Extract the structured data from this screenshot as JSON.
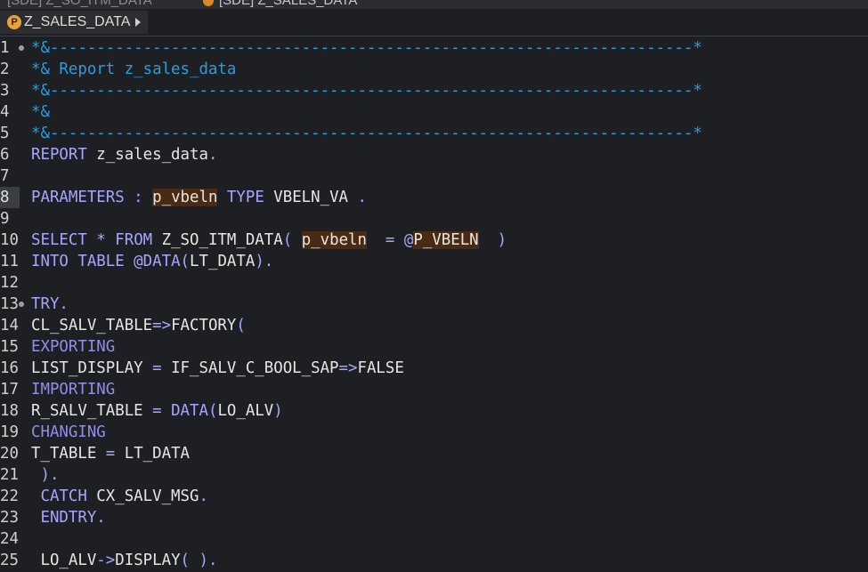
{
  "tabs": [
    {
      "label": "[SDE] Z_SO_ITM_DATA"
    },
    {
      "label": "[SDE] Z_SALES_DATA"
    }
  ],
  "breadcrumb": {
    "icon_letter": "P",
    "label": "Z_SALES_DATA"
  },
  "lines": [
    {
      "n": "1",
      "fold": true,
      "tokens": [
        {
          "t": "*&---------------------------------------------------------------------*",
          "c": "cm"
        }
      ]
    },
    {
      "n": "2",
      "tokens": [
        {
          "t": "*& Report z_sales_data",
          "c": "cm"
        }
      ]
    },
    {
      "n": "3",
      "tokens": [
        {
          "t": "*&---------------------------------------------------------------------*",
          "c": "cm"
        }
      ]
    },
    {
      "n": "4",
      "tokens": [
        {
          "t": "*&",
          "c": "cm"
        }
      ]
    },
    {
      "n": "5",
      "tokens": [
        {
          "t": "*&---------------------------------------------------------------------*",
          "c": "cm"
        }
      ]
    },
    {
      "n": "6",
      "tokens": [
        {
          "t": "REPORT",
          "c": "kw"
        },
        {
          "t": " z_sales_data",
          "c": "id"
        },
        {
          "t": ".",
          "c": "pu"
        }
      ]
    },
    {
      "n": "7",
      "tokens": []
    },
    {
      "n": "8",
      "current": true,
      "tokens": [
        {
          "t": "PARAMETERS",
          "c": "kw"
        },
        {
          "t": " : ",
          "c": "pu"
        },
        {
          "t": "p_vbeln",
          "c": "var"
        },
        {
          "t": " ",
          "c": "id"
        },
        {
          "t": "TYPE",
          "c": "kw"
        },
        {
          "t": " VBELN_VA ",
          "c": "id"
        },
        {
          "t": ".",
          "c": "pu"
        }
      ]
    },
    {
      "n": "9",
      "tokens": []
    },
    {
      "n": "10",
      "tokens": [
        {
          "t": "SELECT",
          "c": "kw"
        },
        {
          "t": " * ",
          "c": "pu"
        },
        {
          "t": "FROM",
          "c": "kw"
        },
        {
          "t": " Z_SO_ITM_DATA",
          "c": "id"
        },
        {
          "t": "( ",
          "c": "pu"
        },
        {
          "t": "p_vbeln",
          "c": "var"
        },
        {
          "t": "  = @",
          "c": "pu"
        },
        {
          "t": "P_VBELN",
          "c": "var"
        },
        {
          "t": "  )",
          "c": "pu"
        }
      ]
    },
    {
      "n": "11",
      "tokens": [
        {
          "t": "INTO TABLE",
          "c": "kw"
        },
        {
          "t": " @",
          "c": "pu"
        },
        {
          "t": "DATA",
          "c": "kw"
        },
        {
          "t": "(",
          "c": "pu"
        },
        {
          "t": "LT_DATA",
          "c": "id"
        },
        {
          "t": ").",
          "c": "pu"
        }
      ]
    },
    {
      "n": "12",
      "tokens": []
    },
    {
      "n": "13",
      "fold": true,
      "tokens": [
        {
          "t": "TRY",
          "c": "kw"
        },
        {
          "t": ".",
          "c": "pu"
        }
      ]
    },
    {
      "n": "14",
      "tokens": [
        {
          "t": "CL_SALV_TABLE",
          "c": "id"
        },
        {
          "t": "=>",
          "c": "pu"
        },
        {
          "t": "FACTORY",
          "c": "id"
        },
        {
          "t": "(",
          "c": "pu"
        }
      ]
    },
    {
      "n": "15",
      "tokens": [
        {
          "t": "EXPORTING",
          "c": "kw2"
        }
      ]
    },
    {
      "n": "16",
      "tokens": [
        {
          "t": "LIST_DISPLAY",
          "c": "id"
        },
        {
          "t": " = ",
          "c": "pu"
        },
        {
          "t": "IF_SALV_C_BOOL_SAP",
          "c": "id"
        },
        {
          "t": "=>",
          "c": "pu"
        },
        {
          "t": "FALSE",
          "c": "id"
        }
      ]
    },
    {
      "n": "17",
      "tokens": [
        {
          "t": "IMPORTING",
          "c": "kw2"
        }
      ]
    },
    {
      "n": "18",
      "tokens": [
        {
          "t": "R_SALV_TABLE",
          "c": "id"
        },
        {
          "t": " = ",
          "c": "pu"
        },
        {
          "t": "DATA",
          "c": "kw"
        },
        {
          "t": "(",
          "c": "pu"
        },
        {
          "t": "LO_ALV",
          "c": "id"
        },
        {
          "t": ")",
          "c": "pu"
        }
      ]
    },
    {
      "n": "19",
      "tokens": [
        {
          "t": "CHANGING",
          "c": "kw2"
        }
      ]
    },
    {
      "n": "20",
      "tokens": [
        {
          "t": "T_TABLE",
          "c": "id"
        },
        {
          "t": " = ",
          "c": "pu"
        },
        {
          "t": "LT_DATA",
          "c": "id"
        }
      ]
    },
    {
      "n": "21",
      "tokens": [
        {
          "t": " ).",
          "c": "pu"
        }
      ]
    },
    {
      "n": "22",
      "tokens": [
        {
          "t": " CATCH",
          "c": "kw"
        },
        {
          "t": " CX_SALV_MSG",
          "c": "id"
        },
        {
          "t": ".",
          "c": "pu"
        }
      ]
    },
    {
      "n": "23",
      "tokens": [
        {
          "t": " ENDTRY",
          "c": "kw"
        },
        {
          "t": ".",
          "c": "pu"
        }
      ]
    },
    {
      "n": "24",
      "tokens": []
    },
    {
      "n": "25",
      "tokens": [
        {
          "t": " LO_ALV",
          "c": "id"
        },
        {
          "t": "->",
          "c": "pu"
        },
        {
          "t": "DISPLAY",
          "c": "id"
        },
        {
          "t": "( ).",
          "c": "pu"
        }
      ]
    }
  ]
}
